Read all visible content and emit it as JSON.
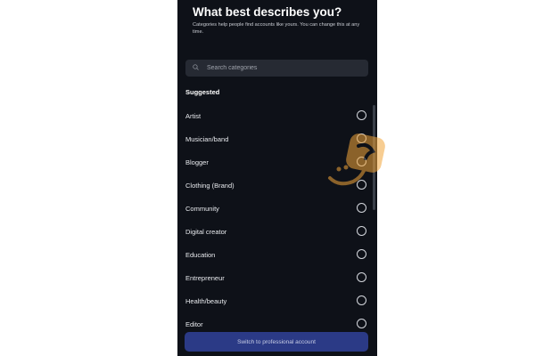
{
  "header": {
    "title": "What best describes you?",
    "subtitle": "Categories help people find accounts like yours. You can change this at any time."
  },
  "search": {
    "placeholder": "Search categories",
    "icon": "search-icon"
  },
  "section": {
    "label": "Suggested"
  },
  "categories": [
    {
      "label": "Artist",
      "selected": false
    },
    {
      "label": "Musician/band",
      "selected": false
    },
    {
      "label": "Blogger",
      "selected": false
    },
    {
      "label": "Clothing (Brand)",
      "selected": false
    },
    {
      "label": "Community",
      "selected": false
    },
    {
      "label": "Digital creator",
      "selected": false
    },
    {
      "label": "Education",
      "selected": false
    },
    {
      "label": "Entrepreneur",
      "selected": false
    },
    {
      "label": "Health/beauty",
      "selected": false
    },
    {
      "label": "Editor",
      "selected": false
    }
  ],
  "footer": {
    "button_label": "Switch to professional account"
  },
  "colors": {
    "background": "#0e1118",
    "search_bg": "#262a33",
    "button_bg": "#2b3a86",
    "watermark": "#f2a53a"
  }
}
